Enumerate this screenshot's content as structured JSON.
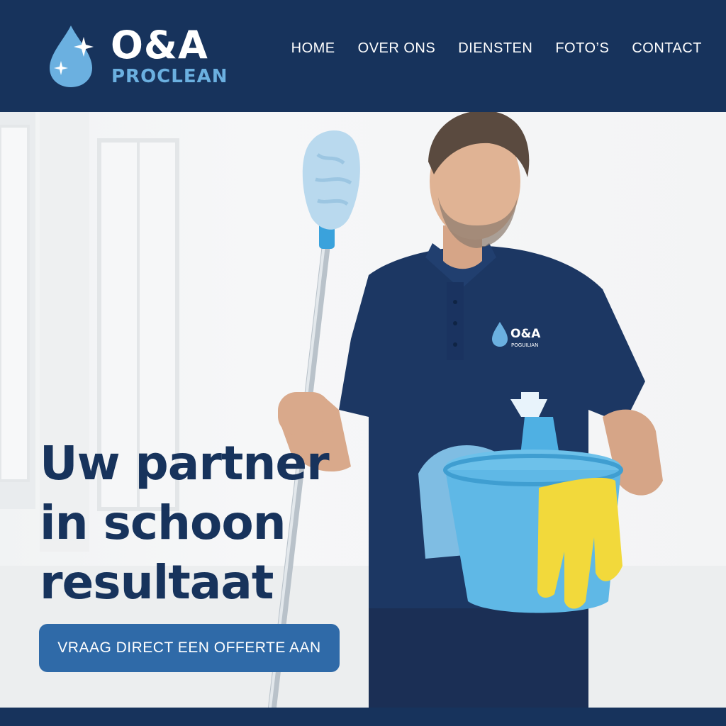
{
  "brand": {
    "name": "O&A",
    "tagline": "PROCLEAN",
    "shirt_logo_name": "O&A",
    "shirt_logo_sub": "POGUILIAN"
  },
  "nav": {
    "items": [
      {
        "label": "HOME"
      },
      {
        "label": "OVER ONS"
      },
      {
        "label": "DIENSTEN"
      },
      {
        "label": "FOTO’S"
      },
      {
        "label": "CONTACT"
      }
    ]
  },
  "hero": {
    "title_lines": [
      "Uw partner",
      "in schoon",
      "resultaat"
    ],
    "cta_label": "VRAAG DIRECT EEN OFFERTE AAN"
  },
  "colors": {
    "navy": "#17335c",
    "accent_blue": "#6bb0e0",
    "button_blue": "#2f6aa8",
    "glove_yellow": "#f2d93b",
    "bucket_blue": "#5fb8e6"
  },
  "icons": {
    "logo": "water-drop-sparkle-icon"
  }
}
